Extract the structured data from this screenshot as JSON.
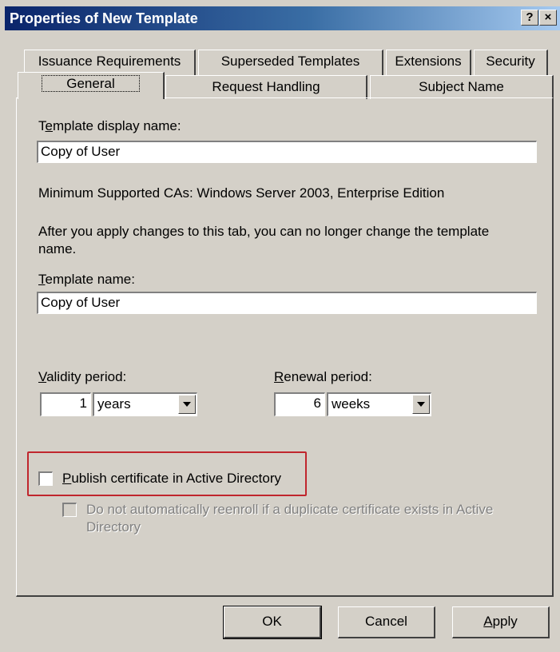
{
  "window": {
    "title": "Properties of New Template",
    "help_button": "?",
    "close_button": "×"
  },
  "tabs_row1": [
    "Issuance Requirements",
    "Superseded Templates",
    "Extensions",
    "Security"
  ],
  "tabs_row2": [
    "General",
    "Request Handling",
    "Subject Name"
  ],
  "active_tab": "General",
  "general": {
    "display_name_label": "Template display name:",
    "display_name_value": "Copy of User",
    "min_ca_text": "Minimum Supported CAs:  Windows Server 2003, Enterprise Edition",
    "warning_line1": "After you apply changes to this tab, you can no longer change the template",
    "warning_line2": "name.",
    "template_name_label": "Template name:",
    "template_name_value": "Copy of User",
    "validity_label": "Validity period:",
    "validity_number": "1",
    "validity_unit": "years",
    "renewal_label": "Renewal period:",
    "renewal_number": "6",
    "renewal_unit": "weeks",
    "publish_label": "Publish certificate in Active Directory",
    "publish_checked": false,
    "reenroll_line1": "Do not automatically reenroll if a duplicate certificate exists in Active",
    "reenroll_line2": "Directory",
    "reenroll_checked": false
  },
  "buttons": {
    "ok": "OK",
    "cancel": "Cancel",
    "apply": "Apply"
  },
  "colors": {
    "titlebar_start": "#0a246a",
    "titlebar_end": "#a6caf0",
    "highlight_border": "#c0262d",
    "dialog_face": "#d4d0c8"
  }
}
